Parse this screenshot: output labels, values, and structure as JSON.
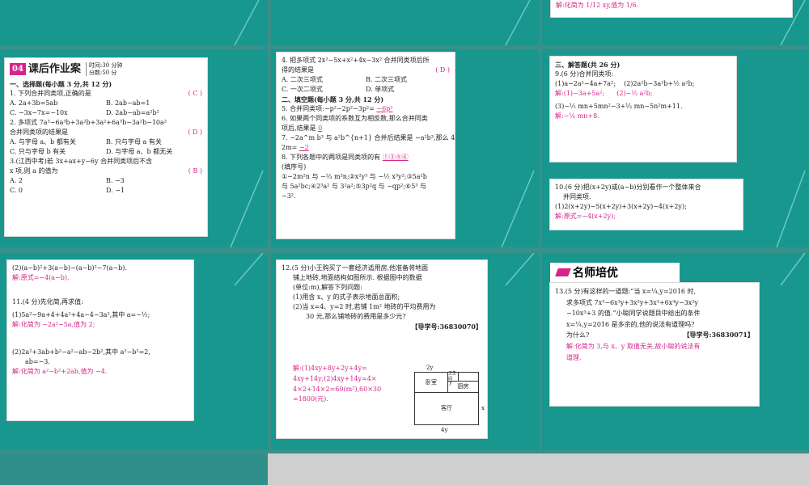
{
  "slide1": {
    "banner_num": "04",
    "banner_title": "课后作业案",
    "banner_time": "时间:30 分钟",
    "banner_score": "分数:50 分",
    "sec1": "一、选择题(每小题 3 分,共 12 分)",
    "q1": "1. 下列合并同类项,正确的是",
    "q1_ans": "( C )",
    "q1_a": "A. 2a+3b=5ab",
    "q1_b": "B. 2ab−ab=1",
    "q1_c": "C. −3x−7x=−10x",
    "q1_d": "D. 2ab−ab=a²b²",
    "q2": "2. 多项式 7a³−6a³b+3a²b+3a²+6a³b−3a²b−10a²",
    "q2_cont": "合并同类项的结果是",
    "q2_ans": "( D )",
    "q2_a": "A. 与字母 a、b 都有关",
    "q2_b": "B. 只与字母 a 有关",
    "q2_c": "C. 只与字母 b 有关",
    "q2_d": "D. 与字母 a、b 都无关",
    "q3": "3.(江西中考)若 3x+ax+y−6y 合并同类项后不含",
    "q3_cont": "x 项,则 a 的值为",
    "q3_ans": "( B )",
    "q3_a": "A. 2",
    "q3_b": "B. −3",
    "q3_c": "C. 0",
    "q3_d": "D. −1"
  },
  "slide2": {
    "q4": "4. 把多项式 2x²−5x+x²+4x−3x² 合并同类项后所",
    "q4_cont": "得的结果是",
    "q4_ans": "( D )",
    "q4_a": "A. 二次三项式",
    "q4_b": "B. 二次三项式",
    "q4_c": "C. 一次二项式",
    "q4_d": "D. 单项式",
    "sec2": "二、填空题(每小题 3 分,共 12 分)",
    "q5": "5. 合并同类项:−p²−2p²−3p²=",
    "q5_ans": "−6p²",
    "q6": "6. 如果两个同类项的系数互为相反数,那么合并同类",
    "q6_cont": "项后,结果是",
    "q6_ans": "0",
    "q7": "7. −2a^m b³ 与 a²b^{n+1} 合并后结果是 −a²b³,那么 4n−",
    "q7_cont": "2m=",
    "q7_ans": "−2",
    "q8": "8. 下列各题中的两项是同类项的有",
    "q8_ans": "①③⑤⑥",
    "q8_cont": "(填序号)",
    "q8_items": "①−2m²n 与 −⅔ m²n;②x²y³ 与 −½ x³y²;③5a²b",
    "q8_items2": "与 5a²bc;④2³a² 与 3²a²;⑤3p²q 与 −qp²;⑥5³ 与",
    "q8_items3": "−3²."
  },
  "slide3": {
    "top_answer": "解:化简为 1/12 xy,值为 1/6.",
    "sec3": "三、解答题(共 26 分)",
    "q9": "9.(6 分)合并同类项:",
    "q9_1": "(1)a−2a²−4a+7a²;",
    "q9_2": "(2)2a²b−3a²b+½ a²b;",
    "q9_1_ans": "解:(1)−3a+5a²;",
    "q9_2_ans": "(2)−½ a²b;",
    "q9_3": "(3)−½ mn+5mn²−3+⅓ mn−5n²m+11.",
    "q9_3_ans": "解:−⅙ mn+8.",
    "q10": "10.(6 分)把(x+2y)或(a−b)分别看作一个整体来合",
    "q10_cont": "并同类项.",
    "q10_1": "(1)2(x+2y)−5(x+2y)+3(x+2y)−4(x+2y);",
    "q10_1_ans": "解:原式=−4(x+2y);"
  },
  "slide4": {
    "q10_2": "(2)(a−b)²+3(a−b)−(a−b)²−7(a−b).",
    "q10_2_ans": "解:原式=−4(a−b).",
    "q11": "11.(4 分)先化简,再求值:",
    "q11_1": "(1)5a²−9a+4+4a²+4a−4−3a²,其中 a=−½;",
    "q11_1_ans": "解:化简为 −2a²−5a,值为 2;",
    "q11_2": "(2)2a²+3ab+b²−a²−ab−2b²,其中 a²−b²=2,",
    "q11_2_cont": "ab=−3.",
    "q11_2_ans": "解:化简为 a²−b²+2ab,值为 −4."
  },
  "slide5": {
    "q12": "12.(5 分)小王购买了一套经济适用房,他准备将地面",
    "q12_l2": "铺上地砖,地面结构如图所示. 根据图中的数据",
    "q12_l3": "(单位:m),解答下列问题:",
    "q12_1": "(1)用含 x、y 的式子表示地面总面积;",
    "q12_2": "(2)当 x=4、y=2 时,若铺 1m² 地砖的平均费用为",
    "q12_2b": "30 元,那么铺地砖的费用是多少元?",
    "guide": "【导学号:36830070】",
    "ans1": "解:(1)4xy+8y+2y+4y=",
    "ans2": "4xy+14y;(2)4xy+14y=4×",
    "ans3": "4×2+14×2=60(m²),60×30",
    "ans4": "=1800(元).",
    "room_bed": "卧室",
    "room_bath": "卫生间",
    "room_kitchen": "厨房",
    "room_living": "客厅",
    "dim_2y": "2y",
    "dim_4y": "4y",
    "dim_x": "x",
    "dim_y": "y"
  },
  "slide6": {
    "header": "名师培优",
    "q13": "13.(5 分)有这样的一道题:“当 x=¼,y=2016 时,",
    "q13_l2": "求多项式 7x³−6x³y+3x²y+3x³+6x³y−3x²y",
    "q13_l3": "−10x³+3 的值.”小聪同学说题目中给出的条件",
    "q13_l4": "x=¼,y=2016 是多余的,他的说法有道理吗?",
    "q13_l5": "为什么?",
    "guide": "【导学号:36830071】",
    "ans1": "解:化简为 3,与 x、y 取值无关,故小聪的说法有",
    "ans2": "道理."
  },
  "colors": {
    "slide_bg": "#18978f",
    "answer": "#d6248a"
  }
}
